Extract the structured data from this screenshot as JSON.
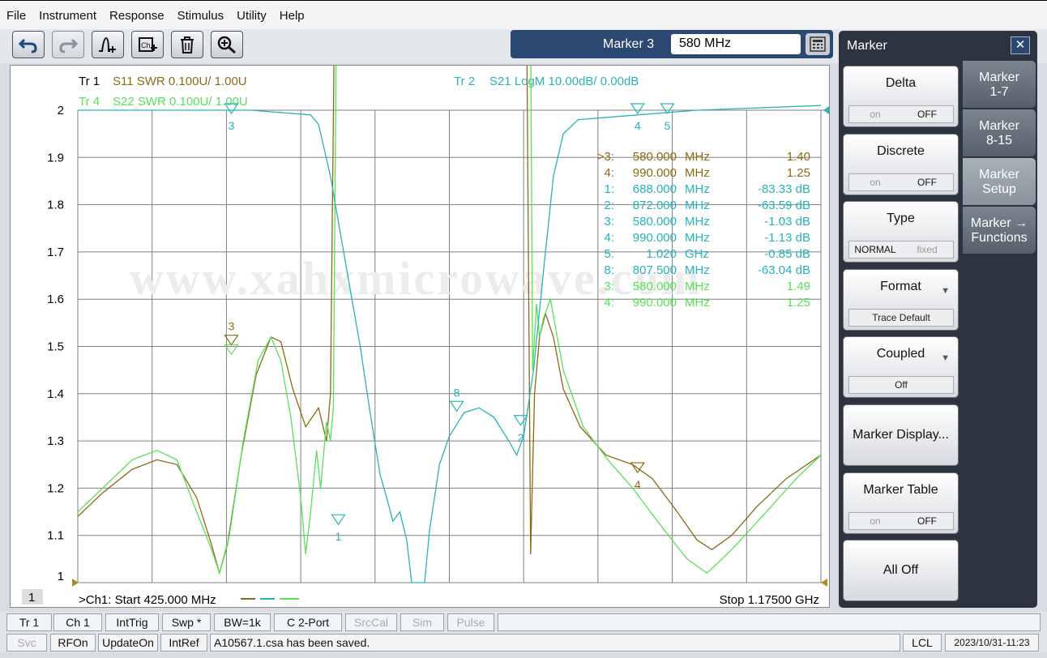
{
  "menu": [
    "File",
    "Instrument",
    "Response",
    "Stimulus",
    "Utility",
    "Help"
  ],
  "marker_entry": {
    "label": "Marker 3",
    "value": "580 MHz"
  },
  "traces": {
    "tr1": {
      "tag": "Tr 1",
      "desc": "S11 SWR 0.100U/  1.00U",
      "color": "#8b6a14"
    },
    "tr2": {
      "tag": "Tr 2",
      "desc": "S21 LogM 10.00dB/  0.00dB",
      "color": "#27b3b7"
    },
    "tr4": {
      "tag": "Tr 4",
      "desc": "S22 SWR 0.100U/  1.00U",
      "color": "#59e059"
    }
  },
  "y_axis": [
    "2",
    "1.9",
    "1.8",
    "1.7",
    "1.6",
    "1.5",
    "1.4",
    "1.3",
    "1.2",
    "1.1",
    "1"
  ],
  "marker_readout": [
    {
      "id": ">3:",
      "freq": "580.000",
      "unit": "MHz",
      "val": "1.40",
      "trace": "tr1"
    },
    {
      "id": "4:",
      "freq": "990.000",
      "unit": "MHz",
      "val": "1.25",
      "trace": "tr1"
    },
    {
      "id": "1:",
      "freq": "688.000",
      "unit": "MHz",
      "val": "-83.33 dB",
      "trace": "tr2"
    },
    {
      "id": "2:",
      "freq": "872.000",
      "unit": "MHz",
      "val": "-63.59 dB",
      "trace": "tr2"
    },
    {
      "id": "3:",
      "freq": "580.000",
      "unit": "MHz",
      "val": "-1.03 dB",
      "trace": "tr2"
    },
    {
      "id": "4:",
      "freq": "990.000",
      "unit": "MHz",
      "val": "-1.13 dB",
      "trace": "tr2"
    },
    {
      "id": "5:",
      "freq": "1.020",
      "unit": "GHz",
      "val": "-0.85 dB",
      "trace": "tr2"
    },
    {
      "id": "8:",
      "freq": "807.500",
      "unit": "MHz",
      "val": "-63.04 dB",
      "trace": "tr2"
    },
    {
      "id": "3:",
      "freq": "580.000",
      "unit": "MHz",
      "val": "1.49",
      "trace": "tr4"
    },
    {
      "id": "4:",
      "freq": "990.000",
      "unit": "MHz",
      "val": "1.25",
      "trace": "tr4"
    }
  ],
  "watermark": "www.xahxmicrowave.com",
  "channel": {
    "num": "1",
    "start": ">Ch1:  Start  425.000 MHz",
    "stop": "Stop  1.17500 GHz"
  },
  "status1": [
    "Tr 1",
    "Ch 1",
    "IntTrig",
    "Swp *",
    "BW=1k",
    "C  2-Port",
    "SrcCal",
    "Sim",
    "Pulse"
  ],
  "status2": {
    "svc": "Svc",
    "rfon": "RFOn",
    "update": "UpdateOn",
    "intref": "IntRef",
    "msg": "A10567.1.csa has been saved.",
    "lcl": "LCL",
    "datetime": "2023/10/31-11:23"
  },
  "panel": {
    "title": "Marker",
    "close": "✕",
    "buttons": {
      "delta": {
        "label": "Delta",
        "on": "on",
        "off": "OFF"
      },
      "discrete": {
        "label": "Discrete",
        "on": "on",
        "off": "OFF"
      },
      "type": {
        "label": "Type",
        "a": "NORMAL",
        "b": "fixed"
      },
      "format": {
        "label": "Format",
        "sub": "Trace Default"
      },
      "coupled": {
        "label": "Coupled",
        "sub": "Off"
      },
      "display": {
        "label": "Marker Display..."
      },
      "table": {
        "label": "Marker Table",
        "on": "on",
        "off": "OFF"
      },
      "alloff": {
        "label": "All Off"
      }
    },
    "tabs": [
      "Marker\n1-7",
      "Marker\n8-15",
      "Marker\nSetup",
      "Marker →\nFunctions"
    ]
  },
  "chart_data": {
    "type": "line",
    "x_range_mhz": [
      425,
      1175
    ],
    "series": [
      {
        "name": "S11 SWR",
        "markers": [
          {
            "label": "3",
            "x": 580,
            "y": 1.4
          },
          {
            "label": "4",
            "x": 990,
            "y": 1.25
          }
        ]
      },
      {
        "name": "S21 LogM",
        "markers": [
          {
            "label": "1",
            "x": 688,
            "y": -83.33
          },
          {
            "label": "2",
            "x": 872,
            "y": -63.59
          },
          {
            "label": "3",
            "x": 580,
            "y": -1.03
          },
          {
            "label": "4",
            "x": 990,
            "y": -1.13
          },
          {
            "label": "5",
            "x": 1020,
            "y": -0.85
          },
          {
            "label": "8",
            "x": 807.5,
            "y": -63.04
          }
        ]
      },
      {
        "name": "S22 SWR",
        "markers": [
          {
            "label": "3",
            "x": 580,
            "y": 1.49
          },
          {
            "label": "4",
            "x": 990,
            "y": 1.25
          }
        ]
      }
    ]
  }
}
